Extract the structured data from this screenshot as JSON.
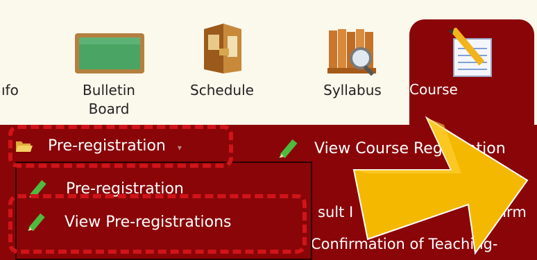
{
  "nav": {
    "tabs": [
      {
        "label": "Info",
        "icon": "info-icon",
        "visible_label": "ıfo"
      },
      {
        "label": "Bulletin Board",
        "icon": "chalkboard-icon"
      },
      {
        "label": "Schedule",
        "icon": "planner-icon"
      },
      {
        "label": "Syllabus",
        "icon": "books-magnifier-icon"
      },
      {
        "label": "Course",
        "icon": "notepad-pencil-icon",
        "active": true
      }
    ],
    "bulletin_line1": "Bulletin",
    "bulletin_line2": "Board"
  },
  "menu": {
    "preregistration": "Pre-registration",
    "view_course_registration": "View Course Registration"
  },
  "dropdown": {
    "items": [
      "Pre-registration",
      "View Pre-registrations"
    ]
  },
  "background_rows": {
    "row1_right": "on",
    "row2_left": "sult I",
    "row2_right": "Confirm",
    "row3_text": "Confirmation of Teaching-"
  },
  "colors": {
    "menu_bg": "#8a0508",
    "page_bg": "#fbf8ec",
    "highlight_dash": "#d0141a",
    "arrow": "#f5b800"
  }
}
